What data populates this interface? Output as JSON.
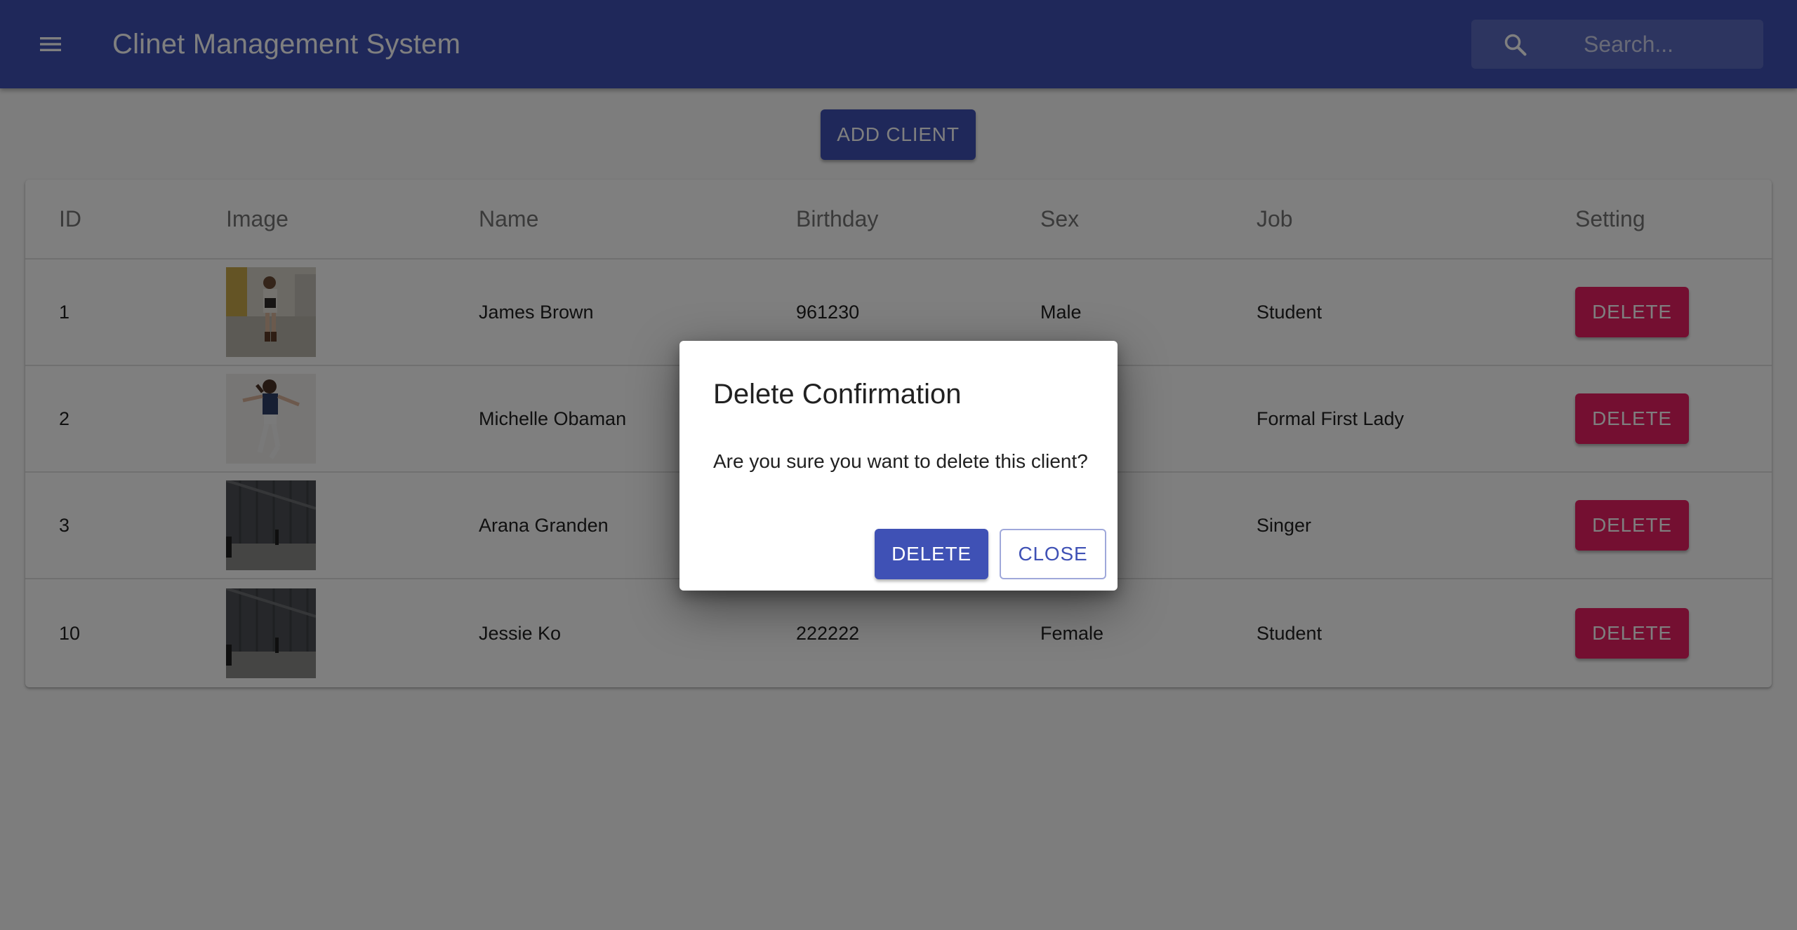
{
  "colors": {
    "primary": "#3f51b5",
    "secondary": "#e91e63",
    "surface": "#ffffff",
    "background": "#fafafa"
  },
  "appbar": {
    "title": "Clinet Management System",
    "menu_icon": "menu-icon",
    "search": {
      "icon": "search-icon",
      "placeholder": "Search...",
      "value": ""
    }
  },
  "toolbar": {
    "add_label": "ADD CLIENT"
  },
  "table": {
    "columns": [
      "ID",
      "Image",
      "Name",
      "Birthday",
      "Sex",
      "Job",
      "Setting"
    ],
    "rows": [
      {
        "id": "1",
        "image": "client-photo",
        "name": "James Brown",
        "birthday": "961230",
        "sex": "Male",
        "job": "Student",
        "action": "DELETE"
      },
      {
        "id": "2",
        "image": "client-photo",
        "name": "Michelle Obaman",
        "birthday": "",
        "sex": "",
        "job": "Formal First Lady",
        "action": "DELETE"
      },
      {
        "id": "3",
        "image": "client-photo",
        "name": "Arana Granden",
        "birthday": "",
        "sex": "",
        "job": "Singer",
        "action": "DELETE"
      },
      {
        "id": "10",
        "image": "client-photo",
        "name": "Jessie Ko",
        "birthday": "222222",
        "sex": "Female",
        "job": "Student",
        "action": "DELETE"
      }
    ]
  },
  "dialog": {
    "title": "Delete Confirmation",
    "message": "Are you sure you want to delete this client?",
    "confirm_label": "DELETE",
    "close_label": "CLOSE"
  }
}
